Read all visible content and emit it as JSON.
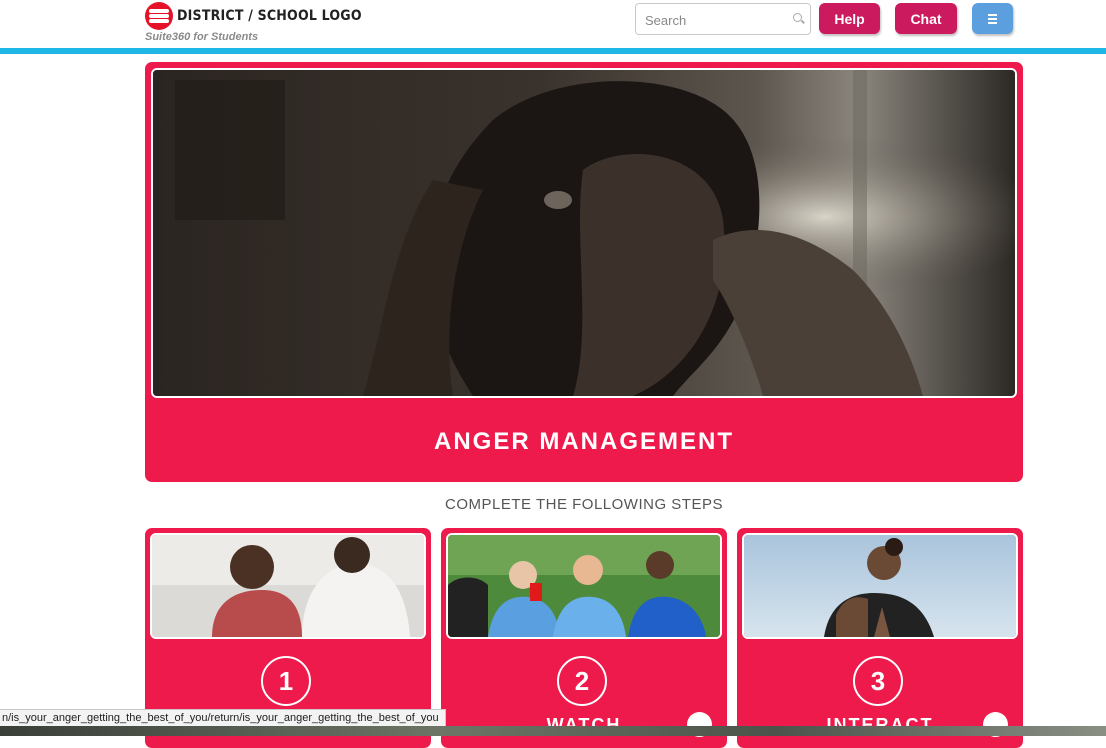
{
  "header": {
    "logo_text": "DISTRICT / SCHOOL LOGO",
    "tagline": "Suite360 for Students",
    "search_placeholder": "Search",
    "help_label": "Help",
    "chat_label": "Chat",
    "menu_icon": "hamburger-menu-icon"
  },
  "hero": {
    "title": "ANGER MANAGEMENT"
  },
  "steps": {
    "heading": "COMPLETE THE FOLLOWING STEPS",
    "cards": [
      {
        "number": "1",
        "label": ""
      },
      {
        "number": "2",
        "label": "WATCH"
      },
      {
        "number": "3",
        "label": "INTERACT"
      }
    ]
  },
  "status_bar": {
    "url": "n/is_your_anger_getting_the_best_of_you/return/is_your_anger_getting_the_best_of_you"
  },
  "colors": {
    "brand_red": "#ee1a4b",
    "button_magenta": "#cc1a5e",
    "menu_blue": "#5b9fde",
    "accent_cyan": "#1fb8e6",
    "logo_red": "#e4132a"
  }
}
